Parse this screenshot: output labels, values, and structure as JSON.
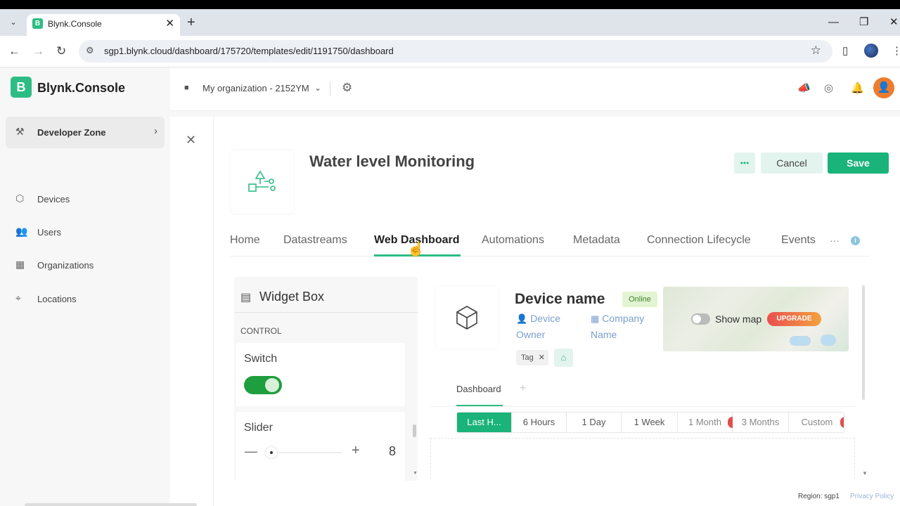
{
  "browser": {
    "tab_title": "Blynk.Console",
    "favicon_letter": "B",
    "url": "sgp1.blynk.cloud/dashboard/175720/templates/edit/1191750/dashboard"
  },
  "app": {
    "logo_letter": "B",
    "logo_text": "Blynk.Console",
    "org_name": "My organization - 2152YM"
  },
  "sidebar": {
    "developer_zone": "Developer Zone",
    "items": [
      {
        "label": "Devices",
        "icon": "cube-icon"
      },
      {
        "label": "Users",
        "icon": "users-icon"
      },
      {
        "label": "Organizations",
        "icon": "building-icon"
      },
      {
        "label": "Locations",
        "icon": "pin-icon"
      }
    ]
  },
  "template": {
    "title": "Water level Monitoring",
    "more_label": "•••",
    "cancel_label": "Cancel",
    "save_label": "Save"
  },
  "tabs": {
    "items": [
      "Home",
      "Datastreams",
      "Web Dashboard",
      "Automations",
      "Metadata",
      "Connection Lifecycle",
      "Events"
    ],
    "active": "Web Dashboard",
    "more": "···"
  },
  "widget_box": {
    "title": "Widget Box",
    "section": "CONTROL",
    "switch_title": "Switch",
    "switch_on": true,
    "slider_title": "Slider",
    "slider_value": "8",
    "minus": "—",
    "plus": "+"
  },
  "device": {
    "name": "Device name",
    "status": "Online",
    "owner_line1": "Device",
    "owner_line2": "Owner",
    "company_line1": "Company",
    "company_line2": "Name",
    "tag": "Tag",
    "show_map": "Show map",
    "upgrade": "UPGRADE"
  },
  "dashboard": {
    "tab": "Dashboard",
    "ranges": [
      "Last H...",
      "6 Hours",
      "1 Day",
      "1 Week",
      "1 Month",
      "3 Months",
      "Custom"
    ],
    "active_range": "Last H..."
  },
  "footer": {
    "region": "Region: sgp1",
    "privacy": "Privacy Policy"
  },
  "colors": {
    "brand": "#2dbd84",
    "save": "#1ab37a",
    "switch": "#1e9e3e",
    "avatar": "#ee7c2c"
  }
}
